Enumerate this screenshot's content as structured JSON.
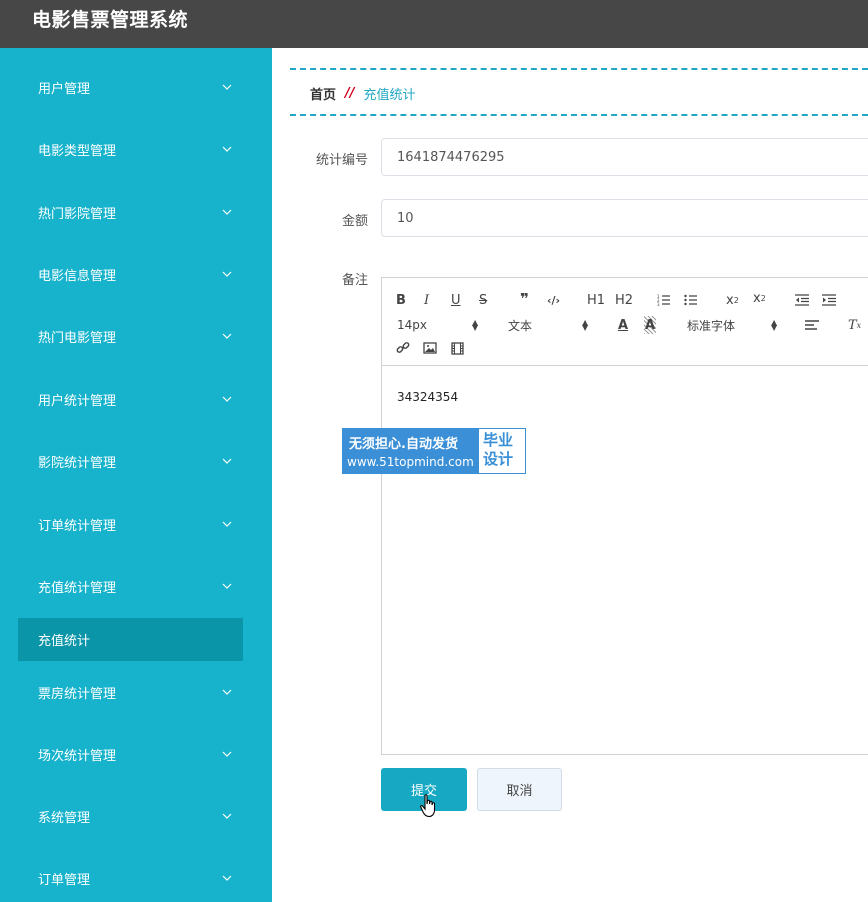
{
  "app": {
    "title": "电影售票管理系统"
  },
  "sidebar": {
    "items": [
      {
        "label": "用户管理"
      },
      {
        "label": "电影类型管理"
      },
      {
        "label": "热门影院管理"
      },
      {
        "label": "电影信息管理"
      },
      {
        "label": "热门电影管理"
      },
      {
        "label": "用户统计管理"
      },
      {
        "label": "影院统计管理"
      },
      {
        "label": "订单统计管理"
      },
      {
        "label": "充值统计管理"
      },
      {
        "label": "票房统计管理"
      },
      {
        "label": "场次统计管理"
      },
      {
        "label": "系统管理"
      },
      {
        "label": "订单管理"
      }
    ],
    "active_sub": {
      "label": "充值统计"
    },
    "chevron_icon": "chevron-down-icon"
  },
  "breadcrumb": {
    "home": "首页",
    "separator": "//",
    "current": "充值统计"
  },
  "form": {
    "code_label": "统计编号",
    "code_value": "1641874476295",
    "amount_label": "金额",
    "amount_value": "10",
    "remark_label": "备注",
    "remark_content": "34324354"
  },
  "editor": {
    "font_size": "14px",
    "text_type": "文本",
    "font_family": "标准字体",
    "h1": "H1",
    "h2": "H2"
  },
  "watermark": {
    "line1": "无须担心.自动发货",
    "line2": "www.51topmind.com",
    "right1": "毕业",
    "right2": "设计"
  },
  "buttons": {
    "submit": "提交",
    "cancel": "取消"
  },
  "colors": {
    "sidebar": "#17b3cc",
    "active": "#0b95a8",
    "topbar": "#474747",
    "accent": "#17a8c3"
  }
}
